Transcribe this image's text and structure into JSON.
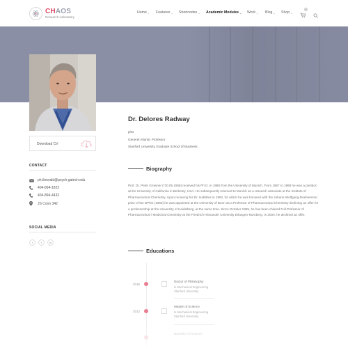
{
  "header": {
    "logo_title_accent": "CH",
    "logo_title_rest": "AOS",
    "logo_subtitle": "Research Laboratory",
    "nav": [
      "Home",
      "Features",
      "Shortcodes",
      "Academic Modules",
      "Work",
      "Blog",
      "Shop"
    ],
    "active_nav": "Academic Modules",
    "cart_count": "0"
  },
  "profile": {
    "name": "Dr. Delores Radway",
    "degree": "phD",
    "role": "Generel Atlantic Professor",
    "school": "Stanford University Graduate School of Business",
    "download_label": "Download CV"
  },
  "sidebar": {
    "contact_title": "CONTACT",
    "email": "ph.tlowrald@psych.gatech.edu",
    "phone1": "404-894-1822",
    "phone2": "404-894-4432",
    "office": "JS Coon 342",
    "social_title": "SOCIAL MEDIA",
    "social": [
      "f",
      "t",
      "in"
    ]
  },
  "main": {
    "bio_title": "Biography",
    "bio_text": "Prof. Dr. Peter Gmeiner (*30.05.1958) received his Ph.D. in 1986 from the University of Munich. From 1987 to 1988 he was a postdoc at the University of California in Berkeley, USA. He subsequently returned to Munich as a research associate at the Institute of Pharmaceutical Chemistry. Upon receiving his Dr. Habilitus in 1992, for which he was honored with the Johann-Wolfgang-Doebereiner prize of the DPhG (1993) he was appointed at the University of Bonn as a Professor of Pharmaceutical Chemistry declining an offer for a professorship at the University of Heidelberg, at the same time. Since October 1995, he has been chaired Full Professor of Pharmaceutical / Medicinal Chemistry at the Friedrich-Alexander University Erlangen-Nurnberg. In 2000, he declined an offer.",
    "edu_title": "Educations",
    "educations": [
      {
        "year": "2015",
        "title": "Doctor of Philosophy",
        "sub1": "in Mechanical Engineering",
        "sub2": "Stanford University"
      },
      {
        "year": "2012",
        "title": "Master of Science",
        "sub1": "in Mechanical Engineering",
        "sub2": "Stanford University"
      }
    ],
    "edu_partial": "Bachelor of Science"
  },
  "colors": {
    "accent": "#e04b64",
    "hero": "#8a8fa6",
    "timeline_dot": "#e97f92"
  }
}
